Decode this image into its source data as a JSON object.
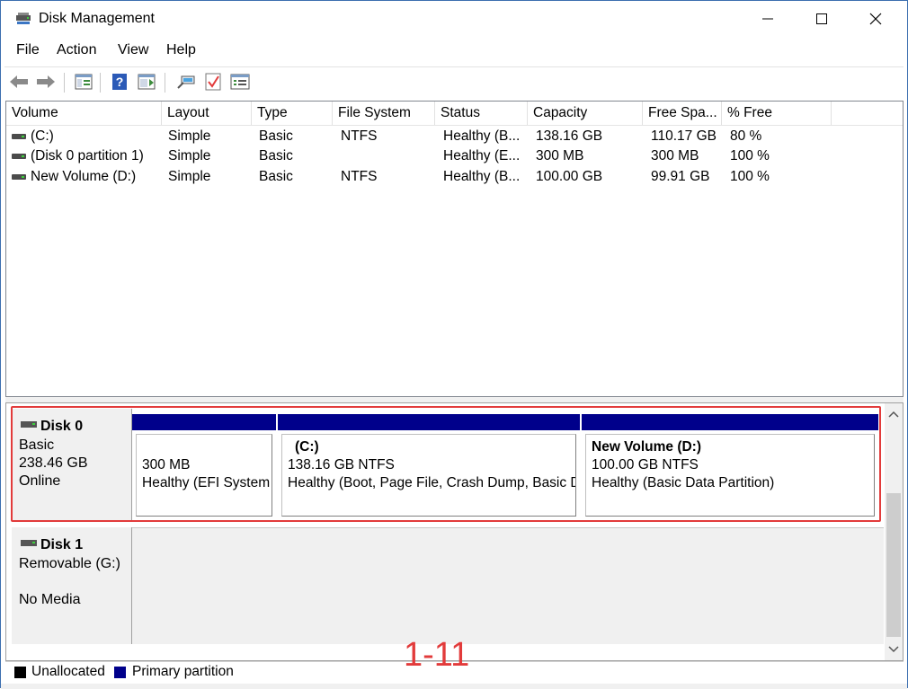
{
  "window": {
    "title": "Disk Management"
  },
  "menu": [
    "File",
    "Action",
    "View",
    "Help"
  ],
  "icons": {
    "app": "disk-management-icon",
    "back": "back-arrow-icon",
    "forward": "forward-arrow-icon",
    "console_tree": "console-tree-icon",
    "help": "help-icon",
    "action_pane": "action-pane-icon",
    "connect": "connect-icon",
    "checklist": "checklist-icon",
    "properties": "properties-icon"
  },
  "columns": [
    "Volume",
    "Layout",
    "Type",
    "File System",
    "Status",
    "Capacity",
    "Free Spa...",
    "% Free"
  ],
  "volumes": [
    {
      "volume": "(C:)",
      "layout": "Simple",
      "type": "Basic",
      "fs": "NTFS",
      "status": "Healthy (B...",
      "capacity": "138.16 GB",
      "free": "110.17 GB",
      "pct": "80 %"
    },
    {
      "volume": "(Disk 0 partition 1)",
      "layout": "Simple",
      "type": "Basic",
      "fs": "",
      "status": "Healthy (E...",
      "capacity": "300 MB",
      "free": "300 MB",
      "pct": "100 %"
    },
    {
      "volume": "New Volume (D:)",
      "layout": "Simple",
      "type": "Basic",
      "fs": "NTFS",
      "status": "Healthy (B...",
      "capacity": "100.00 GB",
      "free": "99.91 GB",
      "pct": "100 %"
    }
  ],
  "disk0": {
    "name": "Disk 0",
    "type": "Basic",
    "size": "238.46 GB",
    "state": "Online",
    "partitions": [
      {
        "title": "",
        "size": "300 MB",
        "status": "Healthy (EFI System"
      },
      {
        "title": "(C:)",
        "size": "138.16 GB NTFS",
        "status": "Healthy (Boot, Page File, Crash Dump, Basic D"
      },
      {
        "title": "New Volume  (D:)",
        "size": "100.00 GB NTFS",
        "status": "Healthy (Basic Data Partition)"
      }
    ]
  },
  "disk1": {
    "name": "Disk 1",
    "type": "Removable (G:)",
    "state": "No Media"
  },
  "legend": {
    "unallocated": "Unallocated",
    "primary": "Primary partition",
    "unallocated_color": "#000000",
    "primary_color": "#00008b"
  },
  "annotation": "1-11"
}
